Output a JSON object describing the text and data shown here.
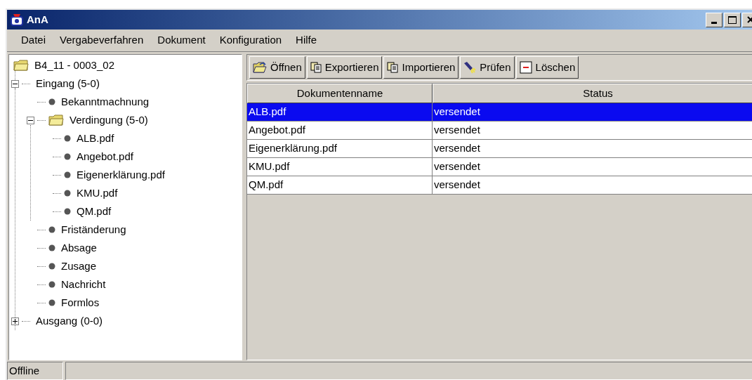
{
  "window": {
    "title": "AnA"
  },
  "menu": [
    {
      "label": "Datei"
    },
    {
      "label": "Vergabeverfahren"
    },
    {
      "label": "Dokument"
    },
    {
      "label": "Konfiguration"
    },
    {
      "label": "Hilfe"
    }
  ],
  "tree": [
    {
      "label": "B4_11 - 0003_02",
      "kind": "folder",
      "children": [
        {
          "label": "Eingang (5-0)",
          "expanded": true,
          "children": [
            {
              "label": "Bekanntmachnung",
              "kind": "bullet"
            },
            {
              "label": "Verdingung (5-0)",
              "kind": "folder",
              "expanded": true,
              "children": [
                {
                  "label": "ALB.pdf",
                  "kind": "bullet"
                },
                {
                  "label": "Angebot.pdf",
                  "kind": "bullet"
                },
                {
                  "label": "Eigenerklärung.pdf",
                  "kind": "bullet"
                },
                {
                  "label": "KMU.pdf",
                  "kind": "bullet"
                },
                {
                  "label": "QM.pdf",
                  "kind": "bullet"
                }
              ]
            },
            {
              "label": "Friständerung",
              "kind": "bullet"
            },
            {
              "label": "Absage",
              "kind": "bullet"
            },
            {
              "label": "Zusage",
              "kind": "bullet"
            },
            {
              "label": "Nachricht",
              "kind": "bullet"
            },
            {
              "label": "Formlos",
              "kind": "bullet"
            }
          ]
        },
        {
          "label": "Ausgang (0-0)",
          "expanded": false
        }
      ]
    }
  ],
  "toolbar": [
    {
      "label": "Öffnen",
      "kind": "open"
    },
    {
      "label": "Exportieren",
      "kind": "copy"
    },
    {
      "label": "Importieren",
      "kind": "copy"
    },
    {
      "label": "Prüfen",
      "kind": "check"
    },
    {
      "label": "Löschen",
      "kind": "delete"
    }
  ],
  "table": {
    "columns": [
      "Dokumentenname",
      "Status"
    ],
    "rows": [
      {
        "cells": [
          "ALB.pdf",
          "versendet"
        ],
        "selected": true
      },
      {
        "cells": [
          "Angebot.pdf",
          "versendet"
        ],
        "selected": false
      },
      {
        "cells": [
          "Eigenerklärung.pdf",
          "versendet"
        ],
        "selected": false
      },
      {
        "cells": [
          "KMU.pdf",
          "versendet"
        ],
        "selected": false
      },
      {
        "cells": [
          "QM.pdf",
          "versendet"
        ],
        "selected": false
      }
    ]
  },
  "status_bar": {
    "text": "Offline"
  }
}
